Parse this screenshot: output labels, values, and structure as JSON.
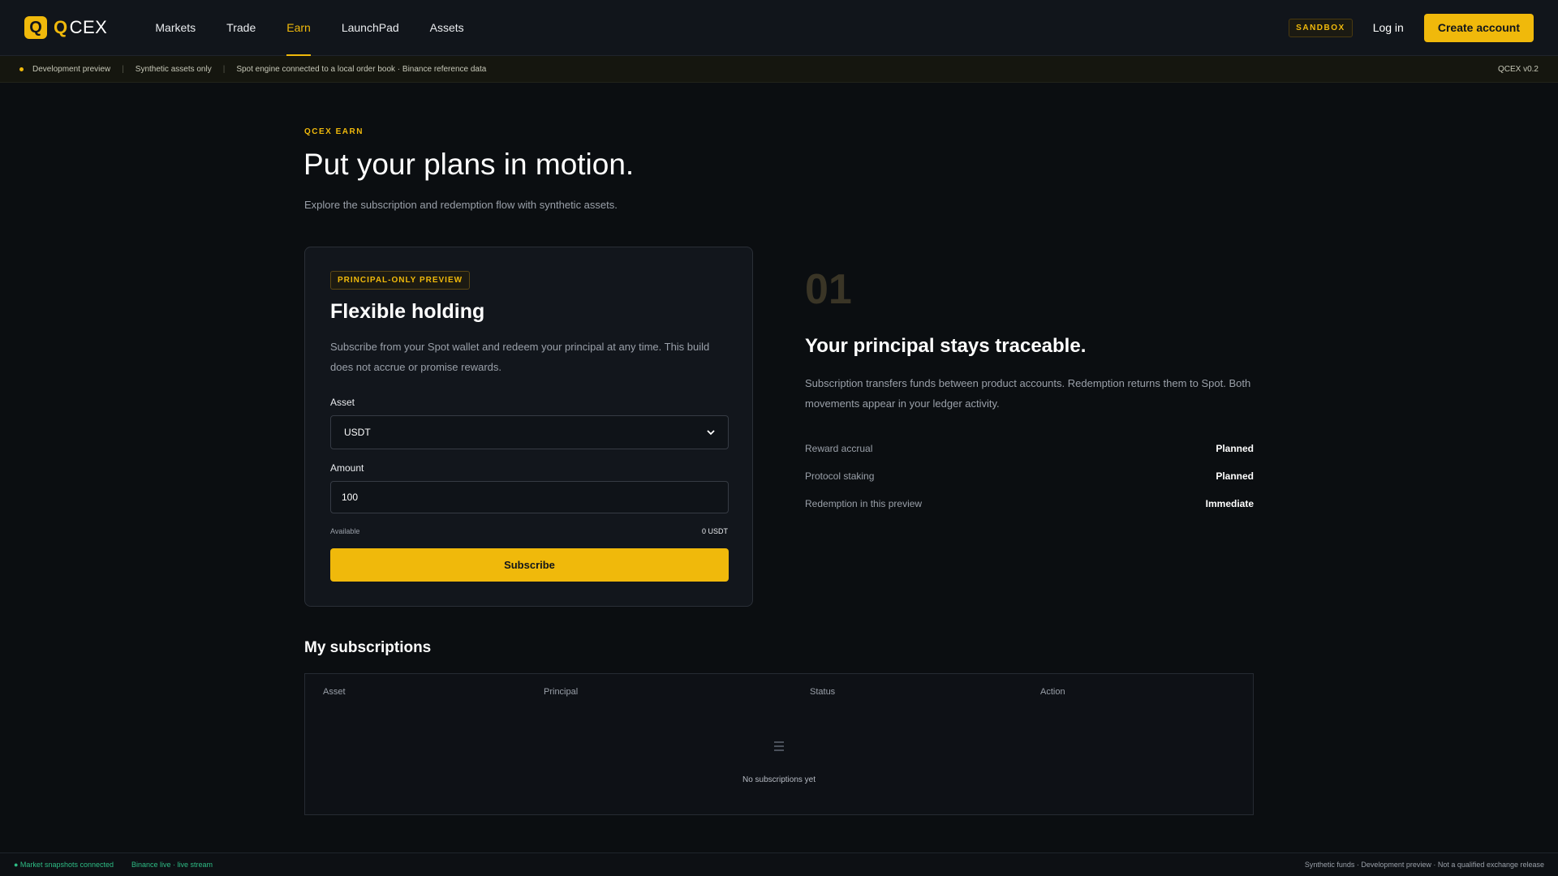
{
  "brand": {
    "logo_letter": "Q",
    "name_prefix": "Q",
    "name": "CEX"
  },
  "nav": {
    "items": [
      {
        "label": "Markets"
      },
      {
        "label": "Trade"
      },
      {
        "label": "Earn"
      },
      {
        "label": "LaunchPad"
      },
      {
        "label": "Assets"
      }
    ],
    "active": "Earn",
    "sandbox": "SANDBOX",
    "login": "Log in",
    "create_account": "Create account"
  },
  "devbar": {
    "items": [
      "Development preview",
      "Synthetic assets only",
      "Spot engine connected to a local order book · Binance reference data"
    ],
    "version": "QCEX v0.2"
  },
  "hero": {
    "eyebrow": "QCEX EARN",
    "title": "Put your plans in motion.",
    "subtitle": "Explore the subscription and redemption flow with synthetic assets."
  },
  "product": {
    "badge": "PRINCIPAL-ONLY PREVIEW",
    "title": "Flexible holding",
    "description": "Subscribe from your Spot wallet and redeem your principal at any time. This build does not accrue or promise rewards.",
    "asset_label": "Asset",
    "asset_value": "USDT",
    "amount_label": "Amount",
    "amount_value": "100",
    "available_label": "Available",
    "available_value": "0 USDT",
    "subscribe": "Subscribe"
  },
  "info": {
    "number": "01",
    "title": "Your principal stays traceable.",
    "description": "Subscription transfers funds between product accounts. Redemption returns them to Spot. Both movements appear in your ledger activity.",
    "rows": [
      {
        "key": "Reward accrual",
        "value": "Planned"
      },
      {
        "key": "Protocol staking",
        "value": "Planned"
      },
      {
        "key": "Redemption in this preview",
        "value": "Immediate"
      }
    ]
  },
  "subscriptions": {
    "title": "My subscriptions",
    "columns": [
      "Asset",
      "Principal",
      "Status",
      "Action"
    ],
    "empty_text": "No subscriptions yet",
    "rows": []
  },
  "statusbar": {
    "market": "● Market snapshots connected",
    "binance": "Binance live · live stream",
    "right": "Synthetic funds · Development preview · Not a qualified exchange release"
  },
  "colors": {
    "accent": "#f0b90b",
    "background": "#0b0e11",
    "positive": "#2ebd85"
  },
  "icons": {
    "select_chevron": "chevron-down-icon",
    "empty_state": "list-icon",
    "dev_dot": "status-dot-icon"
  }
}
